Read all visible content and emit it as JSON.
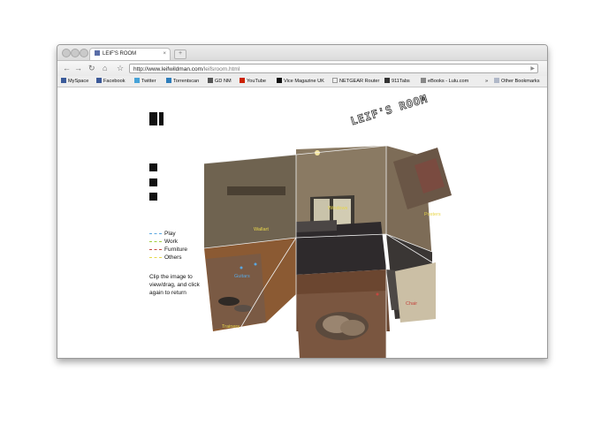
{
  "browser": {
    "tab_title": "LEIF'S ROOM",
    "tab_close": "×",
    "new_tab": "+",
    "url_host": "http://www.leifwildman.com",
    "url_path": "/leifsroom.html",
    "nav": {
      "back": "←",
      "forward": "→",
      "reload": "↻",
      "home": "⌂",
      "star": "☆"
    }
  },
  "bookmarks": [
    {
      "label": "MySpace",
      "color": "#3b5b9a"
    },
    {
      "label": "Facebook",
      "color": "#3b5998"
    },
    {
      "label": "Twitter",
      "color": "#47a3d8"
    },
    {
      "label": "Torrentscan",
      "color": "#2e7dbb"
    },
    {
      "label": "GD NM",
      "color": "#555555"
    },
    {
      "label": "YouTube",
      "color": "#cc2200"
    },
    {
      "label": "Vice Magazine UK",
      "color": "#111111"
    },
    {
      "label": "NETGEAR Router",
      "color": "#eeeeee"
    },
    {
      "label": "911Tabs",
      "color": "#333333"
    },
    {
      "label": "eBooks - Lulu.com",
      "color": "#888888"
    }
  ],
  "bookmarks_overflow": "»",
  "other_bookmarks": "Other Bookmarks",
  "site": {
    "heading_logo": "LEIF'S ROOM",
    "legend": [
      {
        "label": "Play",
        "color": "#5aa7e0"
      },
      {
        "label": "Work",
        "color": "#9fcf3f"
      },
      {
        "label": "Furniture",
        "color": "#c4473f"
      },
      {
        "label": "Others",
        "color": "#e6d94a"
      }
    ],
    "instructions": "Clip the image to view/drag, and click again to return",
    "room_labels": [
      {
        "text": "Windows",
        "color": "#e8d64a"
      },
      {
        "text": "Posters",
        "color": "#e8d64a"
      },
      {
        "text": "Wallart",
        "color": "#e8d64a"
      },
      {
        "text": "Guitars",
        "color": "#5aa7e0"
      },
      {
        "text": "Chair",
        "color": "#c4473f"
      },
      {
        "text": "Trainers",
        "color": "#e8d64a"
      }
    ]
  }
}
